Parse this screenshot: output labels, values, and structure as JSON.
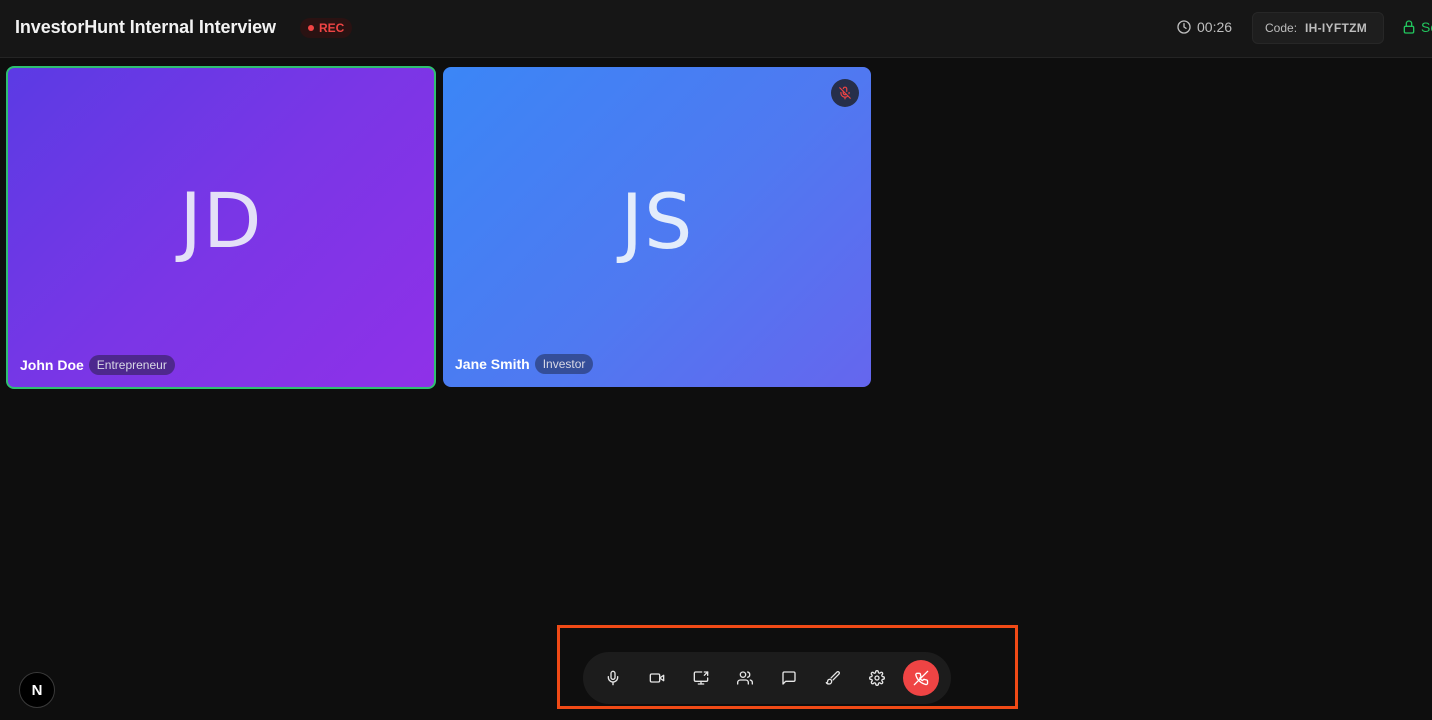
{
  "header": {
    "title": "InvestorHunt Internal Interview",
    "rec_label": "REC",
    "timer": "00:26",
    "code_label": "Code:",
    "code_value": "IH-IYFTZM",
    "secure_label": "Se"
  },
  "participants": [
    {
      "initials": "JD",
      "name": "John Doe",
      "role": "Entrepreneur",
      "active_speaker": true,
      "muted": false
    },
    {
      "initials": "JS",
      "name": "Jane Smith",
      "role": "Investor",
      "active_speaker": false,
      "muted": true
    }
  ],
  "toolbar": {
    "buttons": [
      "microphone",
      "camera",
      "screen-share",
      "participants",
      "chat",
      "whiteboard",
      "settings",
      "end-call"
    ]
  },
  "corner_badge": "N",
  "colors": {
    "rec": "#ef4444",
    "secure": "#22c55e",
    "active_border": "#2fbf71",
    "end_call": "#ef4444",
    "highlight_box": "#f04a16"
  }
}
